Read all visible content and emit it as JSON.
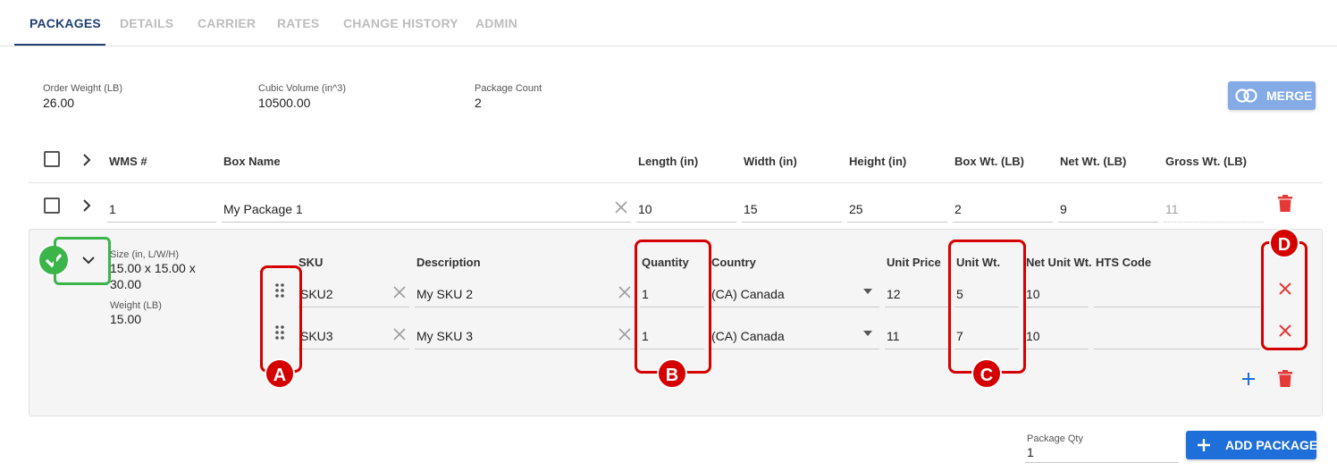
{
  "tabs": [
    {
      "label": "PACKAGES",
      "active": true
    },
    {
      "label": "DETAILS"
    },
    {
      "label": "CARRIER"
    },
    {
      "label": "RATES"
    },
    {
      "label": "CHANGE HISTORY"
    },
    {
      "label": "ADMIN"
    }
  ],
  "summary": {
    "order_weight_label": "Order Weight (LB)",
    "order_weight_value": "26.00",
    "cubic_volume_label": "Cubic Volume (in^3)",
    "cubic_volume_value": "10500.00",
    "package_count_label": "Package Count",
    "package_count_value": "2",
    "merge_label": "MERGE"
  },
  "packages_table": {
    "headers": {
      "wms": "WMS #",
      "box_name": "Box Name",
      "length": "Length (in)",
      "width": "Width (in)",
      "height": "Height (in)",
      "box_wt": "Box Wt. (LB)",
      "net_wt": "Net Wt. (LB)",
      "gross_wt": "Gross Wt. (LB)"
    },
    "row": {
      "wms": "1",
      "box_name": "My Package 1",
      "length": "10",
      "width": "15",
      "height": "25",
      "box_wt": "2",
      "net_wt": "9",
      "gross_wt": "11"
    }
  },
  "detail": {
    "size_label": "Size (in, L/W/H)",
    "size_value_line1": "15.00 x 15.00 x",
    "size_value_line2": "30.00",
    "weight_label": "Weight (LB)",
    "weight_value": "15.00",
    "headers": {
      "sku": "SKU",
      "description": "Description",
      "quantity": "Quantity",
      "country": "Country",
      "unit_price": "Unit Price",
      "unit_wt": "Unit Wt.",
      "net_unit_wt": "Net Unit Wt.",
      "hts_code": "HTS Code"
    },
    "items": [
      {
        "sku": "SKU2",
        "description": "My SKU 2",
        "quantity": "1",
        "country": "(CA) Canada",
        "unit_price": "12",
        "unit_wt": "5",
        "net_unit_wt": "10",
        "hts_code": ""
      },
      {
        "sku": "SKU3",
        "description": "My SKU 3",
        "quantity": "1",
        "country": "(CA) Canada",
        "unit_price": "11",
        "unit_wt": "7",
        "net_unit_wt": "10",
        "hts_code": ""
      }
    ]
  },
  "annotations": {
    "a": "A",
    "b": "B",
    "c": "C",
    "d": "D"
  },
  "footer": {
    "package_qty_label": "Package Qty",
    "package_qty_value": "1",
    "add_package_label": "ADD PACKAGE"
  },
  "colors": {
    "primary": "#1f3f74",
    "accent_blue": "#1e6fd9",
    "merge_blue": "#84abe6",
    "delete_red": "#e53935",
    "annotation_red": "#d50000",
    "annotation_green": "#3bb54a"
  }
}
